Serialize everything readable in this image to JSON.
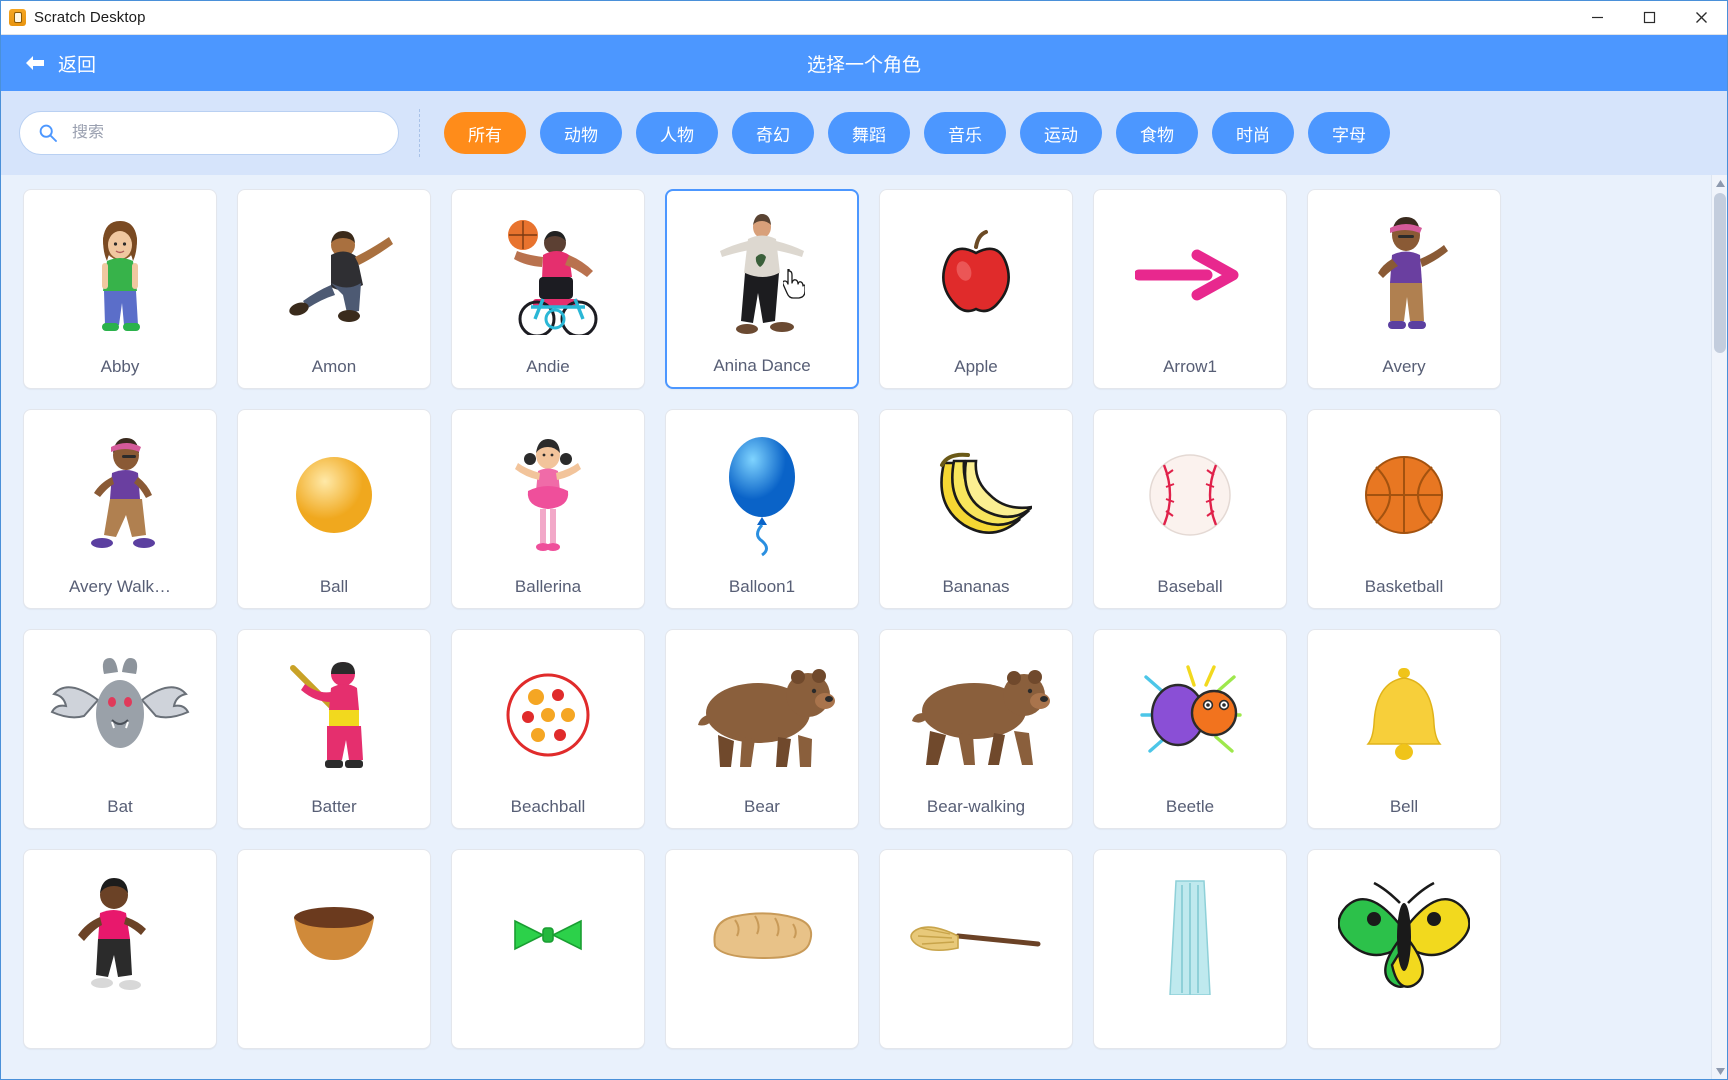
{
  "window": {
    "app_title": "Scratch Desktop",
    "app_icon": "scratch-logo-icon",
    "minimize_label": "—",
    "maximize_label": "□",
    "close_label": "✕"
  },
  "header": {
    "back_label": "返回",
    "title": "选择一个角色",
    "accent_color": "#4c97ff"
  },
  "search": {
    "placeholder": "搜索",
    "value": "",
    "icon": "search-icon"
  },
  "tabs": [
    {
      "label": "所有",
      "active": true
    },
    {
      "label": "动物",
      "active": false
    },
    {
      "label": "人物",
      "active": false
    },
    {
      "label": "奇幻",
      "active": false
    },
    {
      "label": "舞蹈",
      "active": false
    },
    {
      "label": "音乐",
      "active": false
    },
    {
      "label": "运动",
      "active": false
    },
    {
      "label": "食物",
      "active": false
    },
    {
      "label": "时尚",
      "active": false
    },
    {
      "label": "字母",
      "active": false
    }
  ],
  "tab_colors": {
    "active_bg": "#ff8c1a",
    "inactive_bg": "#4c97ff",
    "text": "#ffffff"
  },
  "sprites": [
    {
      "name": "Abby",
      "art": "abby",
      "selected": false
    },
    {
      "name": "Amon",
      "art": "amon",
      "selected": false
    },
    {
      "name": "Andie",
      "art": "andie",
      "selected": false
    },
    {
      "name": "Anina Dance",
      "art": "anina",
      "selected": true
    },
    {
      "name": "Apple",
      "art": "apple",
      "selected": false
    },
    {
      "name": "Arrow1",
      "art": "arrow1",
      "selected": false
    },
    {
      "name": "Avery",
      "art": "avery",
      "selected": false
    },
    {
      "name": "Avery Walk…",
      "art": "avery-walk",
      "selected": false
    },
    {
      "name": "Ball",
      "art": "ball",
      "selected": false
    },
    {
      "name": "Ballerina",
      "art": "ballerina",
      "selected": false
    },
    {
      "name": "Balloon1",
      "art": "balloon1",
      "selected": false
    },
    {
      "name": "Bananas",
      "art": "bananas",
      "selected": false
    },
    {
      "name": "Baseball",
      "art": "baseball",
      "selected": false
    },
    {
      "name": "Basketball",
      "art": "basketball",
      "selected": false
    },
    {
      "name": "Bat",
      "art": "bat",
      "selected": false
    },
    {
      "name": "Batter",
      "art": "batter",
      "selected": false
    },
    {
      "name": "Beachball",
      "art": "beachball",
      "selected": false
    },
    {
      "name": "Bear",
      "art": "bear",
      "selected": false
    },
    {
      "name": "Bear-walking",
      "art": "bear-walking",
      "selected": false
    },
    {
      "name": "Beetle",
      "art": "beetle",
      "selected": false
    },
    {
      "name": "Bell",
      "art": "bell",
      "selected": false
    },
    {
      "name": "",
      "art": "ben",
      "selected": false
    },
    {
      "name": "",
      "art": "bowl",
      "selected": false
    },
    {
      "name": "",
      "art": "bowtie",
      "selected": false
    },
    {
      "name": "",
      "art": "bread",
      "selected": false
    },
    {
      "name": "",
      "art": "broom",
      "selected": false
    },
    {
      "name": "",
      "art": "building",
      "selected": false
    },
    {
      "name": "",
      "art": "butterfly",
      "selected": false
    }
  ],
  "scrollbar": {
    "position_percent": 4
  }
}
